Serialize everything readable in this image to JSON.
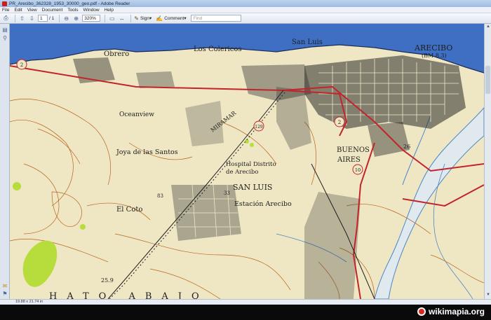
{
  "window": {
    "title": "PR_Arecibo_362328_1953_30000_geo.pdf - Adobe Reader"
  },
  "menu": [
    "File",
    "Edit",
    "View",
    "Document",
    "Tools",
    "Window",
    "Help"
  ],
  "toolbar": {
    "page_current": "1",
    "page_total": "/ 1",
    "zoom": "320%",
    "sign_label": "Sign",
    "comment_label": "Comment",
    "find_placeholder": "Find"
  },
  "map": {
    "labels": {
      "obrero": "Obrero",
      "los_colericos": "Los Colericos",
      "san_luis_top": "San Luis",
      "arecibo": "ARECIBO",
      "bm": "(BM 8.3)",
      "oceanview": "Oceanview",
      "miramar": "MIRAMAR",
      "joya": "Joya de las Santos",
      "hospital1": "Hospital Distrito",
      "hospital2": "de Arecibo",
      "san_luis": "SAN LUIS",
      "estacion": "Estación Arecibo",
      "el_coto": "El Coto",
      "buenos": "BUENOS",
      "aires": "AIRES",
      "hato": "HATO ABAJO",
      "bench": "25.9",
      "num_33": "33",
      "num_83": "83",
      "num_26": "26"
    },
    "routes": {
      "r129": "129",
      "r2": "2",
      "r10": "10",
      "r2_left": "2"
    }
  },
  "status": {
    "page_size": "19.88 x 21.74 in"
  },
  "watermark": {
    "text": "wikimapia.org"
  },
  "colors": {
    "water": "#3f6fc2",
    "paper": "#efe7c4",
    "road": "#c2242a",
    "contour": "#b8641e",
    "vegetation": "#b7dd3c"
  }
}
